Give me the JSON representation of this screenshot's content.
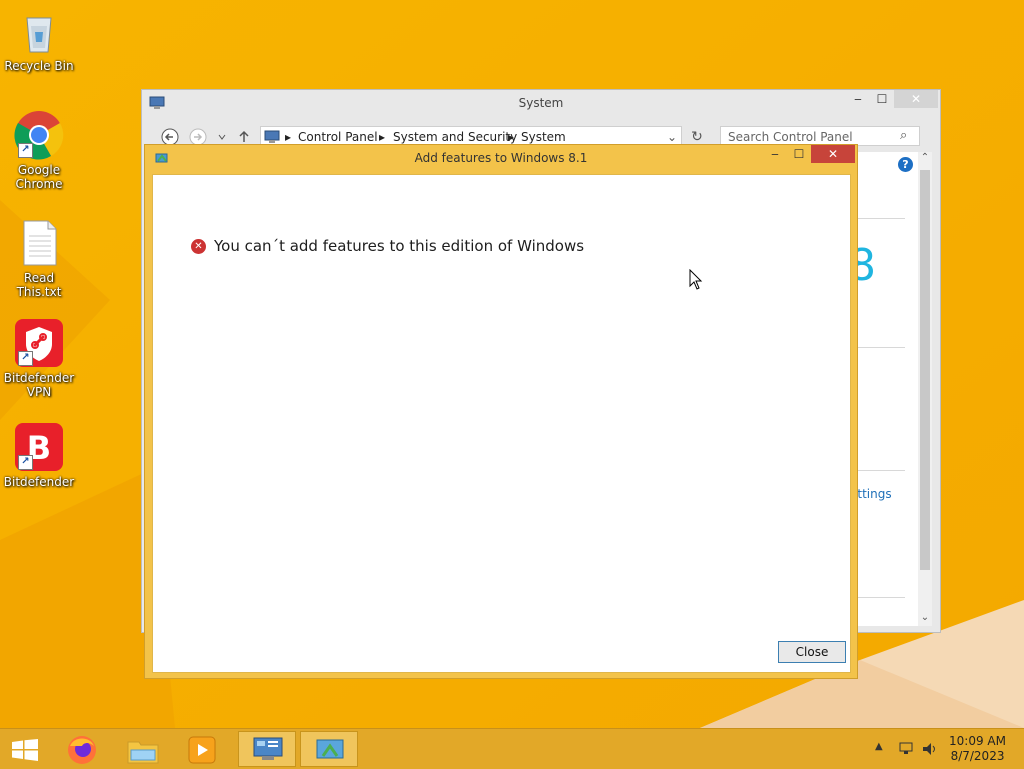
{
  "desktop": {
    "icons": [
      {
        "label": "Recycle Bin"
      },
      {
        "label": "Google Chrome"
      },
      {
        "label": "Read This.txt"
      },
      {
        "label": "Bitdefender VPN"
      },
      {
        "label": "Bitdefender"
      }
    ]
  },
  "system_window": {
    "title": "System",
    "breadcrumb": [
      "Control Panel",
      "System and Security",
      "System"
    ],
    "search_placeholder": "Search Control Panel",
    "partial_text_8": "8",
    "partial_link": "ettings"
  },
  "dialog": {
    "title": "Add features to Windows 8.1",
    "error_message": "You can´t add features to this edition of Windows",
    "close_button": "Close"
  },
  "taskbar": {
    "time": "10:09 AM",
    "date": "8/7/2023"
  },
  "colors": {
    "wallpaper": "#f6b000",
    "dialog_frame": "#f3c34a",
    "close_red": "#c7443a",
    "accent_blue": "#1e88c8"
  }
}
